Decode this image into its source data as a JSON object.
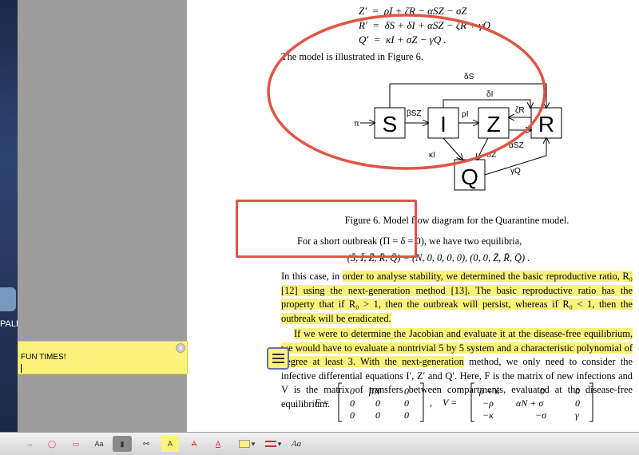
{
  "desktop": {
    "label": "PALM"
  },
  "page": {
    "equations_top": [
      {
        "lhs": "Z′",
        "rhs": "ρI + ζR − αSZ − σZ"
      },
      {
        "lhs": "R′",
        "rhs": "δS + δI + αSZ − ζR + γQ"
      },
      {
        "lhs": "Q′",
        "rhs": "κI + σZ − γQ ."
      }
    ],
    "sentence_illustrated": "The model is illustrated in Figure 6.",
    "diagram": {
      "nodes": [
        "S",
        "I",
        "Z",
        "R",
        "Q"
      ],
      "edge_labels": [
        "δS",
        "δI",
        "π",
        "βSZ",
        "ρI",
        "ζR",
        "κI",
        "σZ",
        "αSZ",
        "γQ"
      ]
    },
    "figure_caption": "Figure 6. Model flow diagram for the Quarantine model.",
    "short_outbreak_line": "For a short outbreak (Π = δ = 0), we have two equilibria,",
    "equilibria_line": "(S̄, Ī, Z̄, R̄, Q̄) = (N, 0, 0, 0, 0), (0, 0, Z̄, R̄, Q̄) .",
    "para1_plain": "In this case, in ",
    "para1_highlight": "order to analyse stability, we determined the basic reproductive ratio, R₀ [12] using the next-generation method [13]. The basic reproductive ratio has the property that if R₀ > 1, then the outbreak will persist, whereas if R₀ < 1, then the outbreak will be eradicated.",
    "para2_highlight": "If we were to determine the Jacobian and evaluate it at the disease-free equilibrium, we would have to evaluate a nontrivial 5 by 5 system and a characteristic polynomial of degree at least 3. With the next-generation",
    "para2_plain": " method, we only need to consider the infective differential equations I′, Z′ and Q′. Here, F is the matrix of new infections and V is the matrix of transfers between compartments, evaluated at the disease-free equilibrium.",
    "matrix_F_label": "F =",
    "matrix_F": [
      [
        "0",
        "βN",
        "0"
      ],
      [
        "0",
        "0",
        "0"
      ],
      [
        "0",
        "0",
        "0"
      ]
    ],
    "matrix_sep": ",",
    "matrix_V_label": "V =",
    "matrix_V": [
      [
        "ρ + κ",
        "0",
        "0"
      ],
      [
        "−ρ",
        "αN + σ",
        "0"
      ],
      [
        "−κ",
        "−σ",
        "γ"
      ]
    ]
  },
  "note": {
    "text": "FUN TIMES!",
    "close_glyph": "×"
  },
  "toolbar": {
    "tools": [
      {
        "name": "arrow-tool",
        "glyph": "→"
      },
      {
        "name": "oval-tool",
        "glyph": "◯"
      },
      {
        "name": "rectangle-tool",
        "glyph": "▭"
      },
      {
        "name": "text-box-tool",
        "glyph": "Aa"
      },
      {
        "name": "note-tool",
        "glyph": "▮"
      },
      {
        "name": "link-tool",
        "glyph": "⚯"
      },
      {
        "name": "highlight-tool",
        "glyph": "A"
      },
      {
        "name": "strikethrough-tool",
        "glyph": "A"
      },
      {
        "name": "underline-tool",
        "glyph": "A"
      },
      {
        "name": "fill-color-tool",
        "glyph": "▾"
      },
      {
        "name": "border-style-tool",
        "glyph": "▾"
      },
      {
        "name": "font-tool",
        "glyph": "Aa"
      }
    ]
  },
  "colors": {
    "annotation": "#e05545",
    "highlight": "#fbf27a"
  }
}
